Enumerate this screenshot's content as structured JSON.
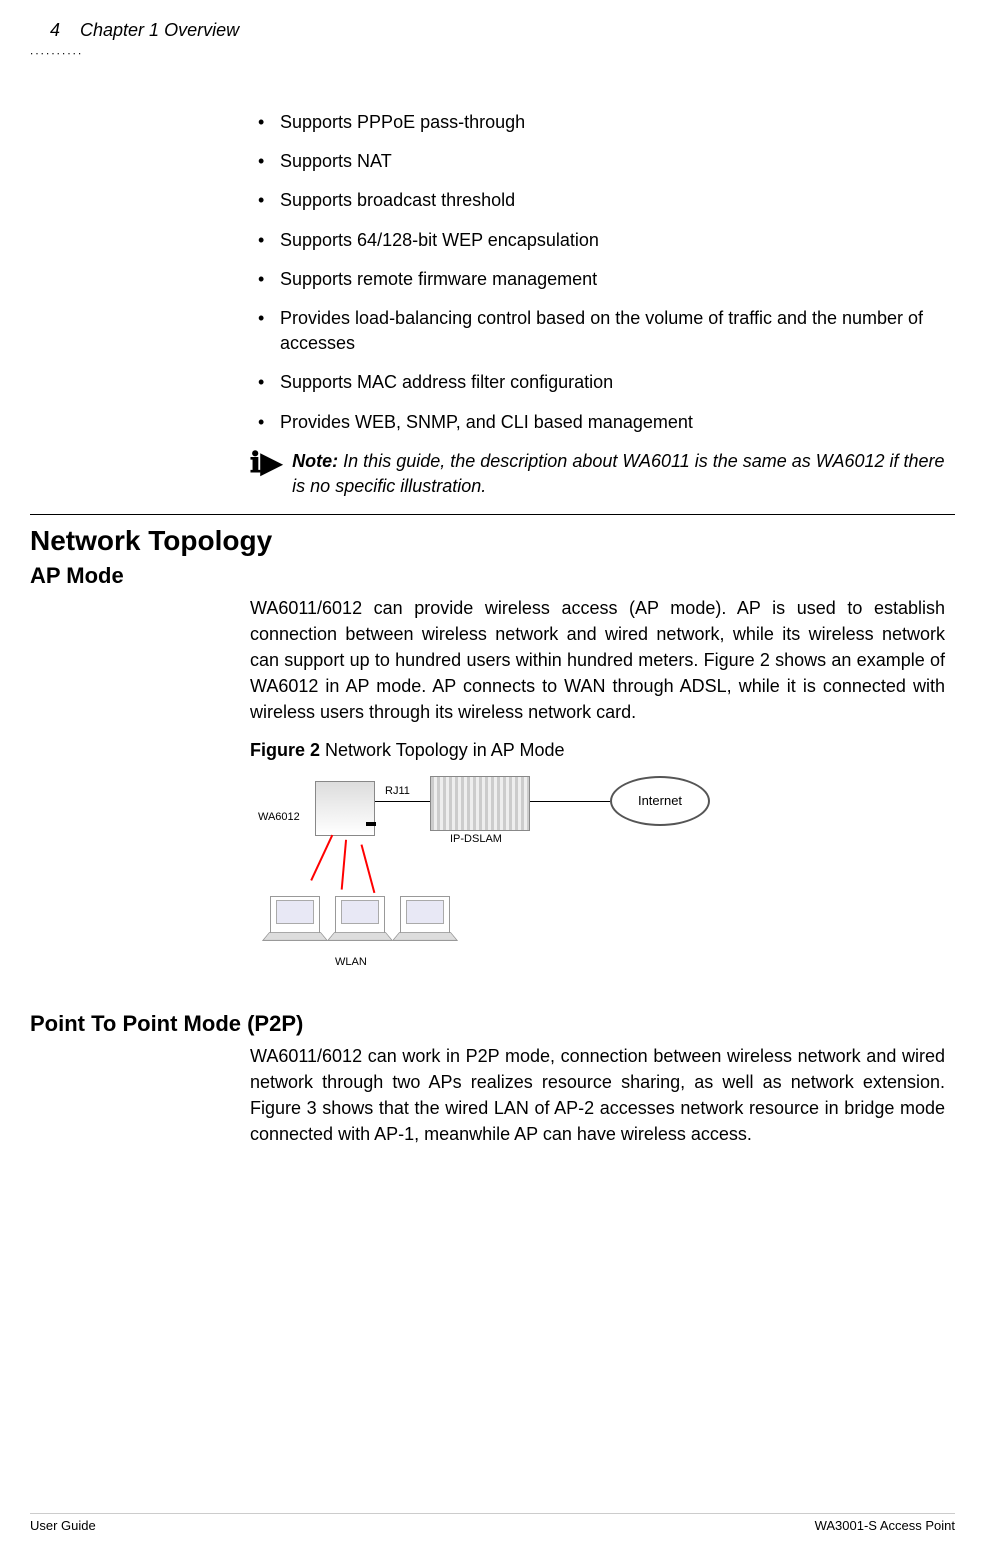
{
  "header": {
    "page_number": "4",
    "chapter": "Chapter 1 Overview"
  },
  "features": {
    "items": [
      "Supports PPPoE pass-through",
      "Supports NAT",
      "Supports broadcast threshold",
      "Supports 64/128-bit WEP encapsulation",
      "Supports remote firmware management",
      "Provides load-balancing control based on the volume of traffic and the number of accesses",
      "Supports MAC address filter configuration",
      "Provides WEB, SNMP, and CLI based management"
    ]
  },
  "note": {
    "label": "Note:",
    "text": " In this guide, the description about WA6011 is the same as WA6012 if there is no specific illustration."
  },
  "network_topology": {
    "title": "Network Topology",
    "ap_mode": {
      "title": "AP Mode",
      "body": "WA6011/6012 can provide wireless access (AP mode). AP is used to establish connection between wireless network and wired network, while its wireless network can support up to hundred users within hundred meters. Figure 2 shows an example of WA6012 in AP mode. AP connects to WAN through ADSL, while it is connected with wireless users through its wireless network card.",
      "figure_label": "Figure 2",
      "figure_caption": " Network Topology in AP Mode",
      "diagram": {
        "ap_label": "WA6012",
        "link_label": "RJ11",
        "dslam_label": "IP-DSLAM",
        "cloud_label": "Internet",
        "wlan_label": "WLAN"
      }
    },
    "p2p": {
      "title": "Point To Point Mode (P2P)",
      "body": "WA6011/6012 can work in P2P mode, connection between wireless network and wired network through two APs realizes resource sharing, as well as network extension. Figure 3 shows that the wired LAN of AP-2 accesses network resource in bridge mode connected with AP-1, meanwhile AP can have wireless access."
    }
  },
  "footer": {
    "left": "User Guide",
    "right": "WA3001-S Access Point"
  }
}
